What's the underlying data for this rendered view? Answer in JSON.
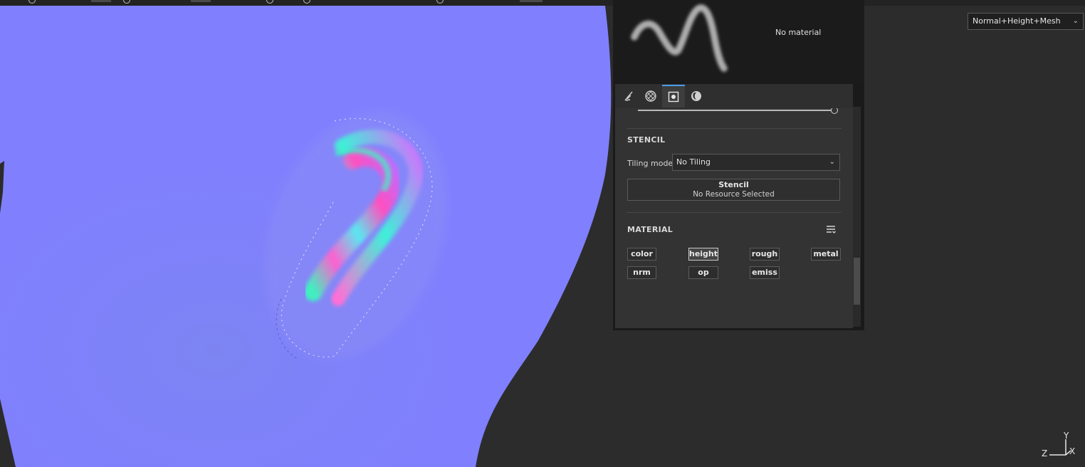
{
  "viewport": {
    "view_mode": {
      "selected": "Normal+Height+Mesh"
    }
  },
  "brush": {
    "material_label": "No material"
  },
  "tabs": [
    {
      "name": "brush-tab",
      "icon": "brush-icon"
    },
    {
      "name": "alpha-tab",
      "icon": "checker-icon"
    },
    {
      "name": "stencil-tab",
      "icon": "stencil-square-icon",
      "active": true
    },
    {
      "name": "material-tab",
      "icon": "material-sphere-icon"
    }
  ],
  "stencil": {
    "title": "STENCIL",
    "tiling_label": "Tiling mode",
    "tiling_value": "No Tiling",
    "slot_title": "Stencil",
    "slot_value": "No Resource Selected"
  },
  "material": {
    "title": "MATERIAL",
    "channels": [
      {
        "label": "color",
        "active": false
      },
      {
        "label": "height",
        "active": true
      },
      {
        "label": "rough",
        "active": false
      },
      {
        "label": "metal",
        "active": false
      },
      {
        "label": "nrm",
        "active": false
      },
      {
        "label": "op",
        "active": false
      },
      {
        "label": "emiss",
        "active": false
      }
    ]
  },
  "axis_gizmo": {
    "y": "Y",
    "z": "Z",
    "x": "X"
  },
  "colors": {
    "mesh_normal": "#8080ff",
    "panel_bg": "#333333",
    "active_tab_accent": "#4a9be8"
  }
}
